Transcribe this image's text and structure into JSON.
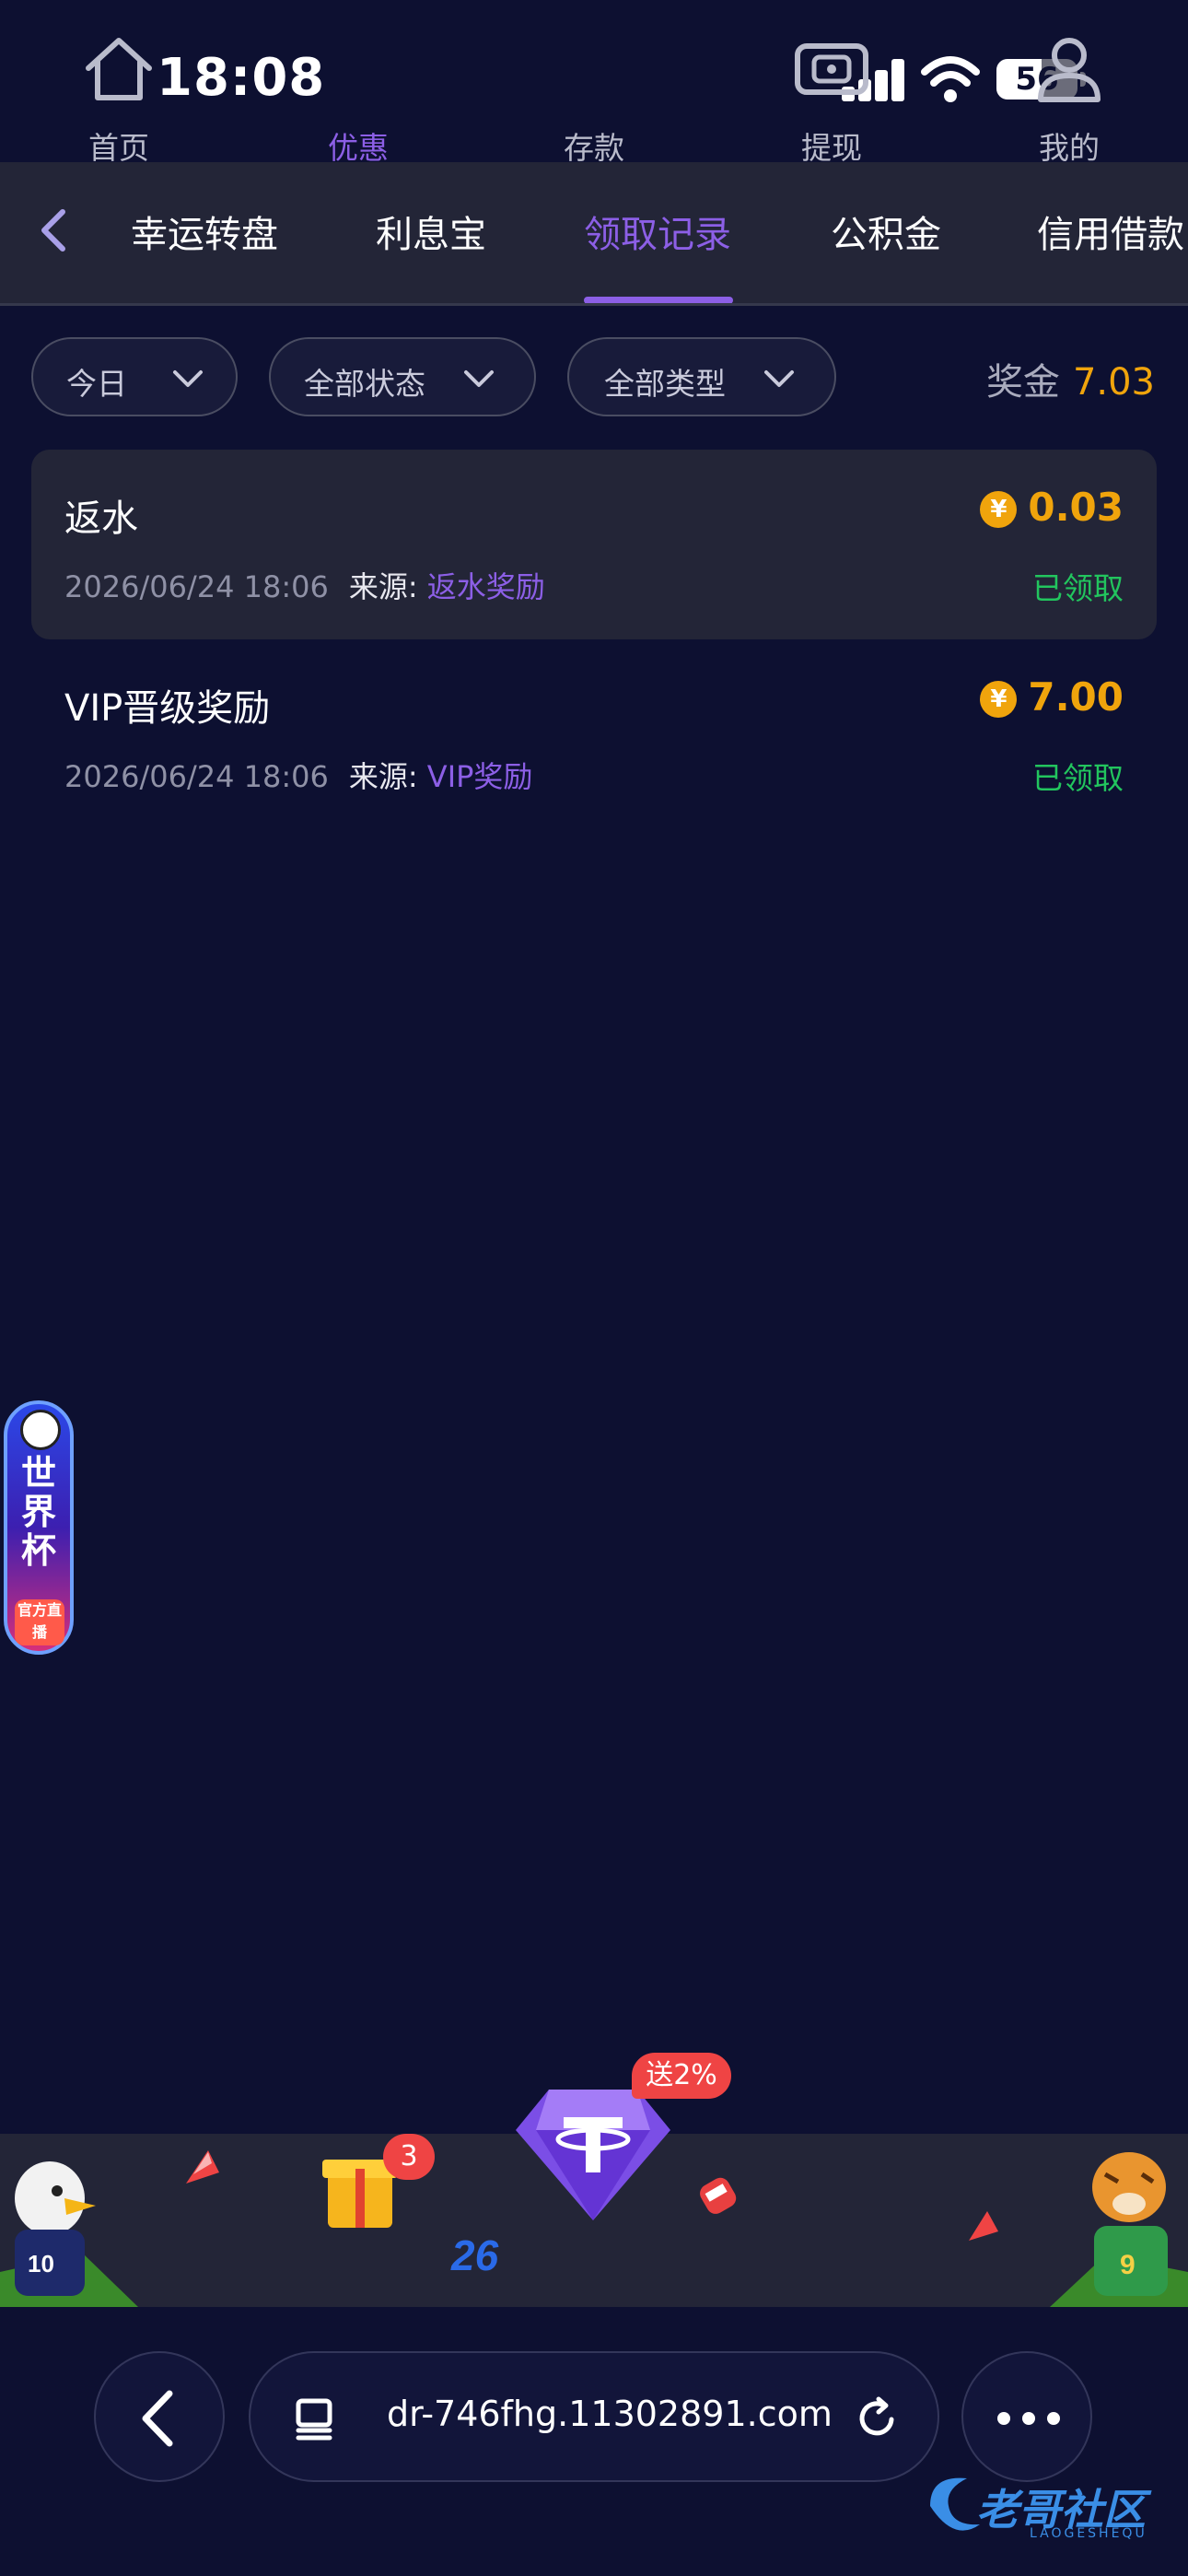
{
  "status_bar": {
    "time": "18:08",
    "battery": "56",
    "battery_level": 0.56
  },
  "tabs": [
    {
      "label": "幸运转盘"
    },
    {
      "label": "利息宝"
    },
    {
      "label": "领取记录",
      "active": true
    },
    {
      "label": "公积金"
    },
    {
      "label": "信用借款"
    }
  ],
  "filters": {
    "date": "今日",
    "status": "全部状态",
    "type": "全部类型"
  },
  "prize": {
    "label": "奖金",
    "value": "7.03"
  },
  "records": [
    {
      "title": "返水",
      "date": "2026/06/24 18:06",
      "source_label": "来源:",
      "source": "返水奖励",
      "amount": "0.03",
      "status": "已领取"
    },
    {
      "title": "VIP晋级奖励",
      "date": "2026/06/24 18:06",
      "source_label": "来源:",
      "source": "VIP奖励",
      "amount": "7.00",
      "status": "已领取"
    }
  ],
  "world_cup": {
    "title": "世界杯",
    "sub": "官方直播"
  },
  "bottom_nav": {
    "home": "首页",
    "promo": "优惠",
    "promo_badge": "3",
    "deposit": "存款",
    "deposit_badge": "送2%",
    "withdraw": "提现",
    "mine": "我的"
  },
  "browser": {
    "url": "dr-746fhg.11302891.com"
  },
  "watermark": {
    "text": "老哥社区",
    "sub": "LAOGESHEQU"
  },
  "colors": {
    "accent": "#8c5fe6",
    "gold": "#f0a40c",
    "success": "#22c55e",
    "badge": "#ef4444",
    "bg": "#0d1031"
  }
}
